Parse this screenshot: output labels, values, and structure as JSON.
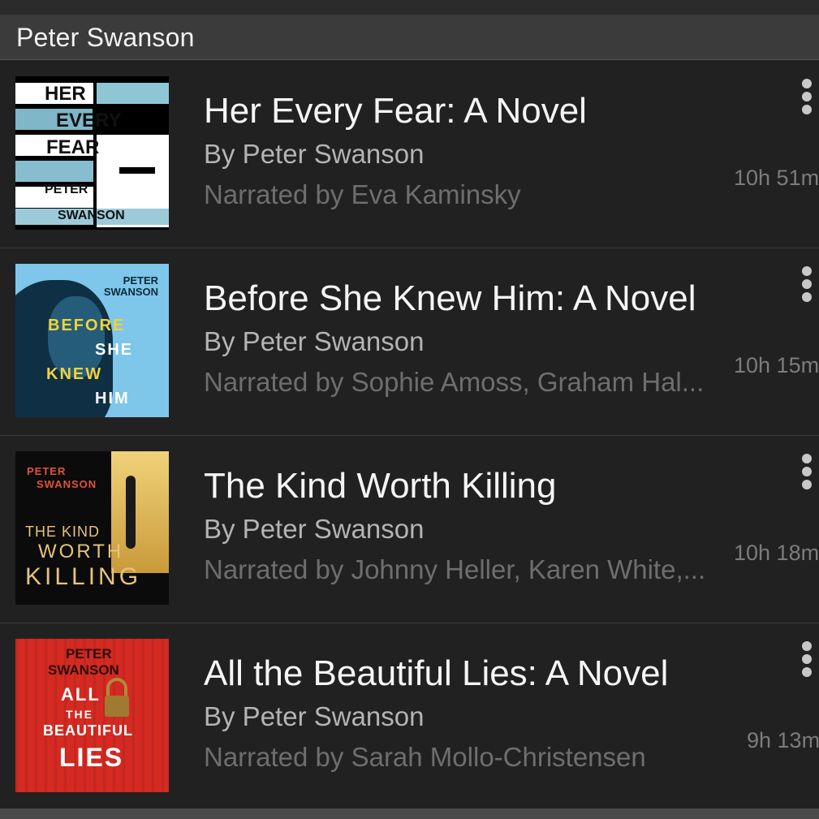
{
  "section": {
    "title": "Peter Swanson"
  },
  "books": [
    {
      "title": "Her Every Fear: A Novel",
      "author": "By Peter Swanson",
      "narrator": "Narrated by Eva Kaminsky",
      "duration": "10h 51m",
      "cover": {
        "lines": [
          "HER",
          "EVERY",
          "FEAR",
          "PETER",
          "SWANSON"
        ]
      }
    },
    {
      "title": "Before She Knew Him: A Novel",
      "author": "By Peter Swanson",
      "narrator": "Narrated by Sophie Amoss, Graham Hal...",
      "duration": "10h 15m",
      "cover": {
        "author": "PETER SWANSON",
        "lines": [
          "BEFORE",
          "SHE",
          "KNEW",
          "HIM"
        ]
      }
    },
    {
      "title": "The Kind Worth Killing",
      "author": "By Peter Swanson",
      "narrator": "Narrated by Johnny Heller, Karen White,...",
      "duration": "10h 18m",
      "cover": {
        "author1": "PETER",
        "author2": "SWANSON",
        "l1": "THE KIND",
        "l2": "WORTH",
        "l3": "KILLING"
      }
    },
    {
      "title": "All the Beautiful Lies: A Novel",
      "author": "By Peter Swanson",
      "narrator": "Narrated by Sarah Mollo-Christensen",
      "duration": "9h 13m",
      "cover": {
        "author1": "PETER",
        "author2": "SWANSON",
        "l1": "ALL",
        "l2": "THE",
        "l3": "BEAUTIFUL",
        "l4": "LIES"
      }
    }
  ],
  "colors": {
    "background": "#212121",
    "header": "#3b3b3b",
    "title_text": "#f5f5f5",
    "author_text": "#b4b4b4",
    "narrator_text": "#6e6e6e"
  },
  "icons": {
    "more": "more-vertical-icon"
  }
}
